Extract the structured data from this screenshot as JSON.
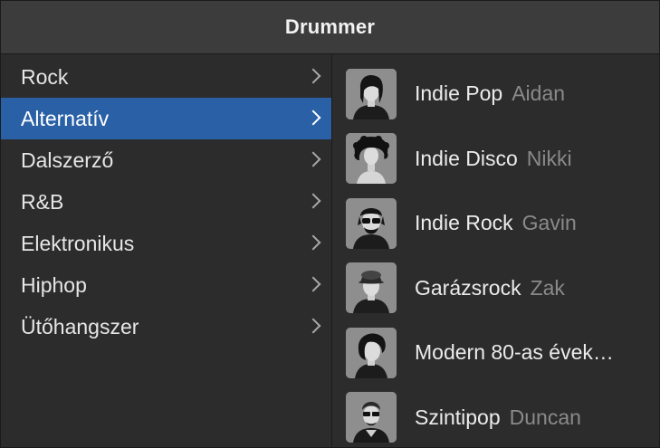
{
  "window": {
    "title": "Drummer"
  },
  "genres": [
    {
      "label": "Rock",
      "selected": false
    },
    {
      "label": "Alternatív",
      "selected": true
    },
    {
      "label": "Dalszerző",
      "selected": false
    },
    {
      "label": "R&B",
      "selected": false
    },
    {
      "label": "Elektronikus",
      "selected": false
    },
    {
      "label": "Hiphop",
      "selected": false
    },
    {
      "label": "Ütőhangszer",
      "selected": false
    }
  ],
  "drummers": [
    {
      "genre": "Indie Pop",
      "name": "Aidan",
      "icon": "drummer-aidan-avatar-icon"
    },
    {
      "genre": "Indie Disco",
      "name": "Nikki",
      "icon": "drummer-nikki-avatar-icon"
    },
    {
      "genre": "Indie Rock",
      "name": "Gavin",
      "icon": "drummer-gavin-avatar-icon"
    },
    {
      "genre": "Garázsrock",
      "name": "Zak",
      "icon": "drummer-zak-avatar-icon"
    },
    {
      "genre": "Modern 80-as évek…",
      "name": "",
      "icon": "drummer-modern-80s-avatar-icon"
    },
    {
      "genre": "Szintipop",
      "name": "Duncan",
      "icon": "drummer-duncan-avatar-icon"
    }
  ],
  "colors": {
    "selection": "#2960a6",
    "background": "#2c2c2c",
    "titlebar": "#3c3c3c",
    "secondary_text": "#8a8a8a"
  }
}
